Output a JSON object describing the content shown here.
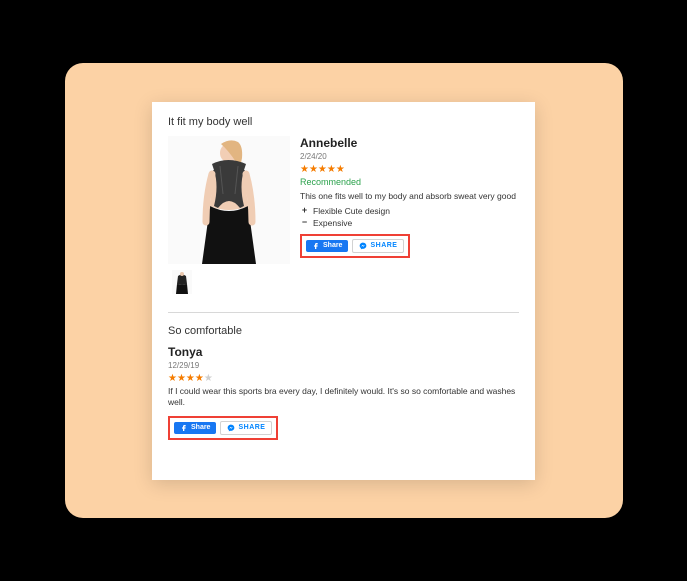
{
  "reviews": [
    {
      "title": "It fit my body well",
      "author": "Annebelle",
      "date": "2/24/20",
      "rating": 5,
      "recommended_label": "Recommended",
      "text": "This one fits well to my body and absorb sweat very good",
      "pro": "Flexible Cute design",
      "con": "Expensive",
      "fb_share_label": "Share",
      "messenger_share_label": "SHARE"
    },
    {
      "title": "So comfortable",
      "author": "Tonya",
      "date": "12/29/19",
      "rating": 4,
      "text": "If I could wear this sports bra every day, I definitely would. It's so so comfortable and washes well.",
      "fb_share_label": "Share",
      "messenger_share_label": "SHARE"
    }
  ]
}
